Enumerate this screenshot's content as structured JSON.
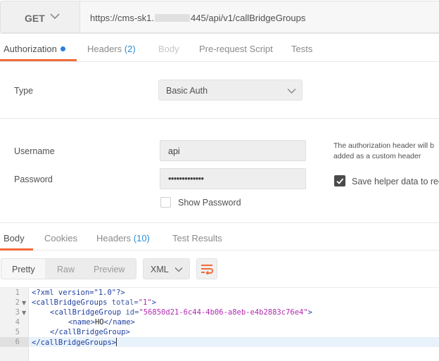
{
  "request": {
    "method": "GET",
    "url_prefix": "https://cms-sk1.",
    "url_suffix": "445/api/v1/callBridgeGroups"
  },
  "request_tabs": [
    {
      "label": "Authorization",
      "active": true
    },
    {
      "label": "Headers",
      "count": "(2)"
    },
    {
      "label": "Body",
      "disabled": true
    },
    {
      "label": "Pre-request Script"
    },
    {
      "label": "Tests"
    }
  ],
  "auth": {
    "type_label": "Type",
    "type_value": "Basic Auth",
    "username_label": "Username",
    "username_value": "api",
    "password_label": "Password",
    "password_value": "•••••••••••••",
    "show_password_label": "Show Password",
    "note_line1": "The authorization header will b",
    "note_line2": "added as a custom header",
    "save_helper_label": "Save helper data to req"
  },
  "response_tabs": [
    {
      "label": "Body",
      "active": true
    },
    {
      "label": "Cookies"
    },
    {
      "label": "Headers",
      "count": "(10)"
    },
    {
      "label": "Test Results"
    }
  ],
  "response_toolbar": {
    "pretty": "Pretty",
    "raw": "Raw",
    "preview": "Preview",
    "format": "XML"
  },
  "editor": {
    "line_numbers": [
      "1",
      "2",
      "3",
      "4",
      "5",
      "6"
    ],
    "line1": "<?xml version=\"1.0\"?>",
    "line2_tag": "<callBridgeGroups",
    "line2_attr": " total=",
    "line2_str": "\"1\"",
    "line2_end": ">",
    "line3_tag": "<callBridgeGroup",
    "line3_attr": " id=",
    "line3_str": "\"56850d21-6c44-4b06-a8eb-e4b2883c76e4\"",
    "line3_end": ">",
    "line4_open": "<name>",
    "line4_text": "HO",
    "line4_close": "</name>",
    "line5": "</callBridgeGroup>",
    "line6": "</callBridgeGroups>"
  },
  "colors": {
    "accent": "#f26b3a",
    "count_blue": "#2a8fd6",
    "dot_blue": "#2a7fe0"
  }
}
